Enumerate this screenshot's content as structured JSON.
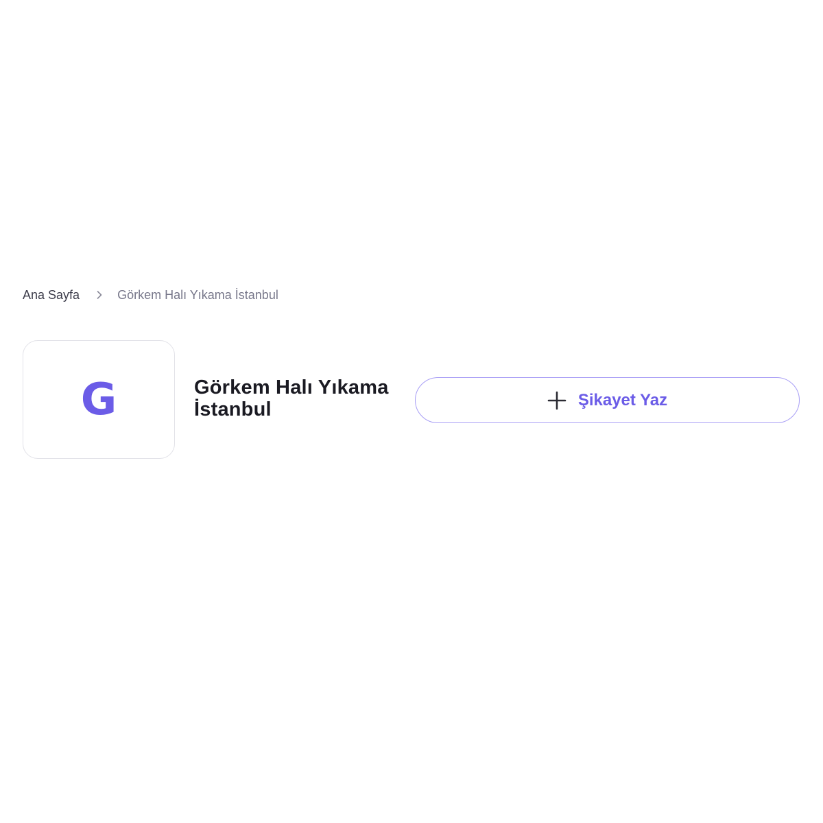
{
  "breadcrumb": {
    "home_label": "Ana Sayfa",
    "separator_icon": "chevron-right-icon",
    "current_label": "Görkem Halı Yıkama İstanbul"
  },
  "company": {
    "logo_letter": "G",
    "name": "Görkem Halı Yıkama İstanbul"
  },
  "actions": {
    "complaint_label": "Şikayet Yaz",
    "complaint_icon": "plus-icon"
  },
  "colors": {
    "accent": "#6b5ce7",
    "button_border": "#a79df5",
    "heading": "#1a1a22",
    "breadcrumb_muted": "#77778a"
  }
}
